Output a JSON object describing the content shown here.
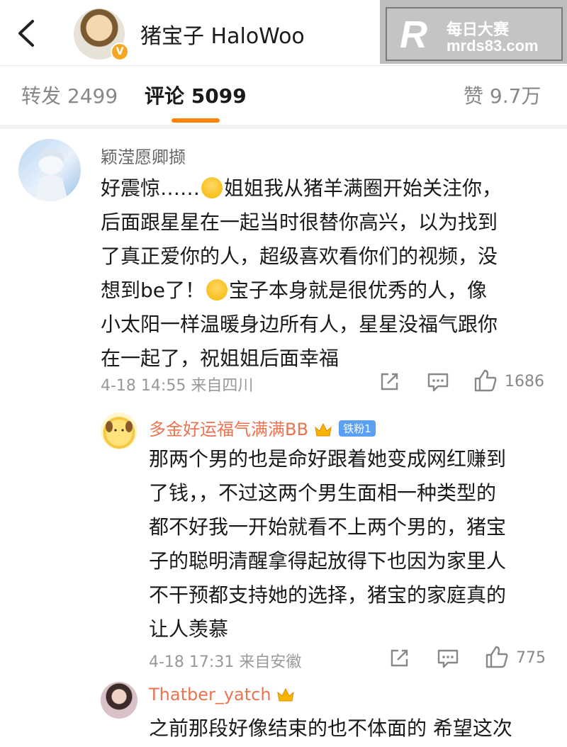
{
  "header": {
    "title": "猪宝子 HaloWoo",
    "verified_badge": "V"
  },
  "watermark": {
    "logo": "R",
    "line1": "每日大赛",
    "line2": "mrds83.com"
  },
  "tabs": [
    {
      "label": "转发 2499"
    },
    {
      "label": "评论 5099",
      "active": true
    },
    {
      "label": "赞 9.7万"
    }
  ],
  "comments": [
    {
      "user": "颖滢愿卿撷",
      "lines": [
        "好震惊……",
        "姐姐我从猪羊满圈开始关注你，",
        "后面跟星星在一起当时很替你高兴，以为找到",
        "了真正爱你的人，超级喜欢看你们的视频，没",
        "想到be了！",
        "宝子本身就是很优秀的人，像",
        "小太阳一样温暖身边所有人，星星没福气跟你",
        "在一起了，祝姐姐后面幸福"
      ],
      "time": "4-18 14:55",
      "location": "来自四川",
      "likes": "1686"
    },
    {
      "user": "多金好运福气满满BB",
      "fan_badge": "铁粉1",
      "lines": [
        "那两个男的也是命好跟着她变成网红赚到",
        "了钱，，不过这两个男生面相一种类型的",
        "都不好我一开始就看不上两个男的，猪宝",
        "子的聪明清醒拿得起放得下也因为家里人",
        "不干预都支持她的选择，猪宝的家庭真的",
        "让人羡慕"
      ],
      "time": "4-18 17:31",
      "location": "来自安徽",
      "likes": "775"
    },
    {
      "user": "Thatber_yatch",
      "lines": [
        "之前那段好像结束的也不体面的 希望这次"
      ]
    }
  ],
  "colors": {
    "accent": "#ff8200",
    "username_gray": "#666666",
    "username_orange": "#eb7350"
  }
}
